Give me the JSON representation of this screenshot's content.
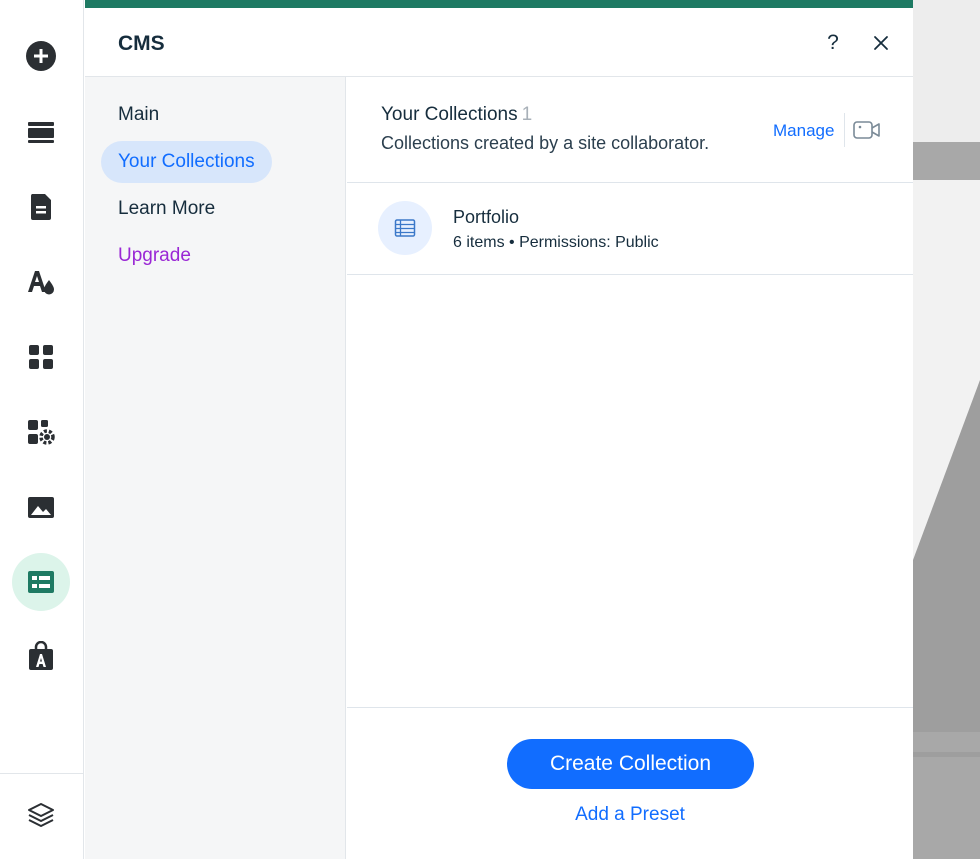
{
  "panel": {
    "title": "CMS",
    "help_label": "?"
  },
  "nav": {
    "items": [
      {
        "label": "Main"
      },
      {
        "label": "Your Collections"
      },
      {
        "label": "Learn More"
      },
      {
        "label": "Upgrade"
      }
    ],
    "active": "Your Collections"
  },
  "collections": {
    "title": "Your Collections",
    "count": "1",
    "subtitle": "Collections created by a site collaborator.",
    "manage_label": "Manage",
    "items": [
      {
        "name": "Portfolio",
        "meta": "6 items • Permissions: Public"
      }
    ]
  },
  "footer": {
    "create_label": "Create Collection",
    "preset_label": "Add a Preset"
  },
  "rail": {
    "icons": [
      "add-icon",
      "sections-icon",
      "pages-icon",
      "theme-icon",
      "apps-icon",
      "business-apps-icon",
      "media-icon",
      "cms-icon",
      "app-market-icon",
      "layers-icon"
    ],
    "active": "cms-icon"
  },
  "colors": {
    "accent": "#116dff",
    "brand_bar": "#1e7a63",
    "upgrade": "#9a27d5",
    "active_nav_bg": "#d7e6fb",
    "active_rail_bg": "#dcf4ea"
  }
}
